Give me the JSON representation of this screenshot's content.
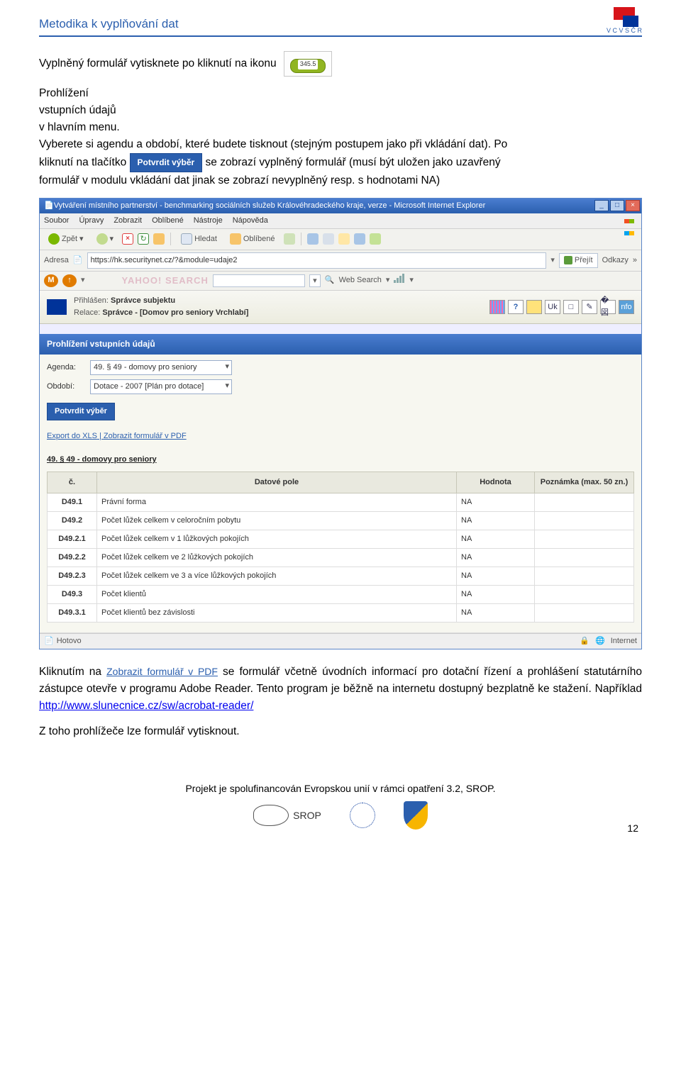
{
  "header": {
    "title": "Metodika k vyplňování dat",
    "logo_caption": "V C V S Č R"
  },
  "doc": {
    "p1a": "Vyplněný formulář vytisknete po kliknutí na ikonu",
    "p1b": "v hlavním menu.",
    "icon_badge": "345.5",
    "icon_caption_l1": "Prohlížení",
    "icon_caption_l2": "vstupních údajů",
    "p2": "Vyberete si agendu a období, které budete tisknout (stejným postupem jako při vkládání dat). Po",
    "p3a": "kliknutí na tlačítko",
    "potvrdit": "Potvrdit výběr",
    "p3b": "se zobrazí vyplněný formulář (musí být uložen jako uzavřený",
    "p4": "formulář v modulu vkládání dat jinak se zobrazí nevyplněný resp. s hodnotami NA)",
    "p5a": "Kliknutím na",
    "pdf_link": "Zobrazit formulář v PDF",
    "p5b": "se formulář včetně úvodních informací pro dotační řízení a prohlášení statutárního zástupce otevře v programu Adobe Reader. Tento program je běžně na internetu dostupný bezplatně ke stažení. Například ",
    "hyperlink": "http://www.slunecnice.cz/sw/acrobat-reader/",
    "p6": "Z toho prohlížeče lze formulář vytisknout."
  },
  "window": {
    "title": "Vytváření místního partnerství - benchmarking sociálních služeb Královéhradeckého kraje, verze  - Microsoft Internet Explorer",
    "menu": [
      "Soubor",
      "Úpravy",
      "Zobrazit",
      "Oblíbené",
      "Nástroje",
      "Nápověda"
    ],
    "toolbar": {
      "back": "Zpět",
      "search": "Hledat",
      "favorites": "Oblíbené"
    },
    "address": {
      "label": "Adresa",
      "url": "https://hk.securitynet.cz/?&module=udaje2",
      "go": "Přejít",
      "links": "Odkazy"
    },
    "yahoo": {
      "logo": "YAHOO! SEARCH",
      "web_search": "Web Search"
    },
    "app": {
      "login_label": "Přihlášen:",
      "login_value": "Správce subjektu",
      "relace_label": "Relace:",
      "relace_value": "Správce - [Domov pro seniory Vrchlabí]",
      "icons": [
        "≡?",
        "?",
        "note",
        "Uk",
        "□",
        "✎",
        "�図",
        "nfo"
      ]
    },
    "panel": {
      "title": "Prohlížení vstupních údajů",
      "agenda_label": "Agenda:",
      "agenda_value": "49. § 49 - domovy pro seniory",
      "obdobi_label": "Období:",
      "obdobi_value": "Dotace - 2007 [Plán pro dotace]",
      "confirm": "Potvrdit výběr",
      "export_xls": "Export do XLS",
      "pdf": "Zobrazit formulář v PDF",
      "section": "49. § 49 - domovy pro seniory"
    },
    "table": {
      "headers": [
        "č.",
        "Datové pole",
        "Hodnota",
        "Poznámka (max. 50 zn.)"
      ],
      "rows": [
        {
          "code": "D49.1",
          "field": "Právní forma",
          "value": "NA",
          "note": ""
        },
        {
          "code": "D49.2",
          "field": "Počet lůžek celkem v celoročním pobytu",
          "value": "NA",
          "note": ""
        },
        {
          "code": "D49.2.1",
          "field": "Počet lůžek celkem v 1 lůžkových pokojích",
          "value": "NA",
          "note": ""
        },
        {
          "code": "D49.2.2",
          "field": "Počet lůžek celkem ve 2 lůžkových pokojích",
          "value": "NA",
          "note": ""
        },
        {
          "code": "D49.2.3",
          "field": "Počet lůžek celkem ve 3 a více lůžkových pokojích",
          "value": "NA",
          "note": ""
        },
        {
          "code": "D49.3",
          "field": "Počet klientů",
          "value": "NA",
          "note": ""
        },
        {
          "code": "D49.3.1",
          "field": "Počet klientů bez závislosti",
          "value": "NA",
          "note": ""
        }
      ]
    },
    "status": {
      "left": "Hotovo",
      "zone": "Internet"
    }
  },
  "footer": {
    "text": "Projekt je spolufinancován Evropskou unií v rámci opatření 3.2, SROP.",
    "srop": "SROP",
    "pagenum": "12"
  }
}
